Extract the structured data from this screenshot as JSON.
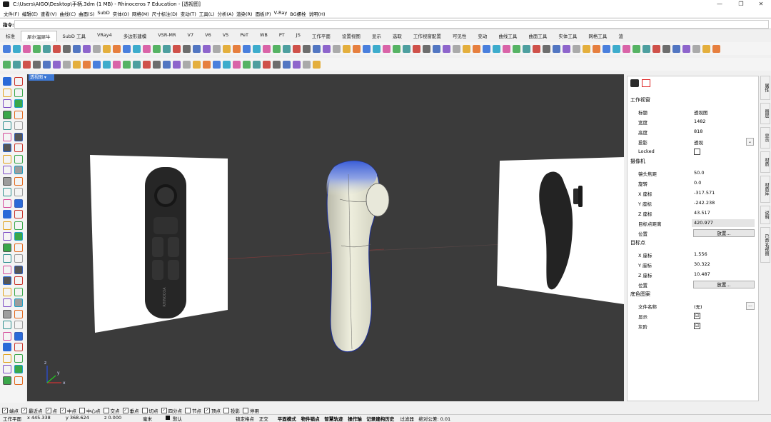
{
  "window": {
    "title": "C:\\Users\\AIGO\\Desktop\\手柄.3dm (1 MB) - Rhinoceros 7 Education - [透视图]",
    "controls": [
      "—",
      "❐",
      "✕"
    ]
  },
  "menu": [
    "文件(F)",
    "编辑(E)",
    "查看(V)",
    "曲线(C)",
    "曲面(S)",
    "SubD",
    "实体(O)",
    "网格(M)",
    "尺寸标注(D)",
    "变动(T)",
    "工具(L)",
    "分析(A)",
    "渲染(R)",
    "面板(P)",
    "V-Ray",
    "BG螺栓",
    "说明(H)"
  ],
  "command": {
    "label": "指令:",
    "value": ""
  },
  "tabs": [
    "标准",
    "犀尔温犀牛",
    "SubD 工具",
    "VRay4",
    "多边形建模",
    "VSR-MR",
    "V7",
    "V6",
    "V5",
    "PeT",
    "WB",
    "PT",
    "JS",
    "工作平面",
    "设置视图",
    "显示",
    "选取",
    "工作视窗配置",
    "可见性",
    "变动",
    "曲线工具",
    "曲面工具",
    "实体工具",
    "网格工具",
    "渲"
  ],
  "active_tab": "犀尔温犀牛",
  "viewport": {
    "label": "透视图"
  },
  "panel": {
    "sections": {
      "viewport": "工作视窗",
      "camera": "摄像机",
      "target": "目标点",
      "wallpaper": "底色图案"
    },
    "viewport_rows": [
      {
        "key": "标题",
        "value": "透视图"
      },
      {
        "key": "宽度",
        "value": "1482"
      },
      {
        "key": "高度",
        "value": "818"
      },
      {
        "key": "投影",
        "value": "透视"
      },
      {
        "key": "Locked",
        "value": ""
      }
    ],
    "camera_rows": [
      {
        "key": "镜头焦距",
        "value": "50.0"
      },
      {
        "key": "旋转",
        "value": "0.0"
      },
      {
        "key": "X 座标",
        "value": "-317.571"
      },
      {
        "key": "Y 座标",
        "value": "-242.238"
      },
      {
        "key": "Z 座标",
        "value": "43.517"
      },
      {
        "key": "目标点距离",
        "value": "420.977"
      },
      {
        "key": "位置",
        "value": "放置..."
      }
    ],
    "target_rows": [
      {
        "key": "X 座标",
        "value": "1.556"
      },
      {
        "key": "Y 座标",
        "value": "30.322"
      },
      {
        "key": "Z 座标",
        "value": "10.487"
      },
      {
        "key": "位置",
        "value": "放置..."
      }
    ],
    "wallpaper_rows": [
      {
        "key": "文件名称",
        "value": "(无)"
      },
      {
        "key": "显示",
        "value": "☑"
      },
      {
        "key": "灰阶",
        "value": "☑"
      }
    ],
    "dots": "..."
  },
  "right_tabs": [
    "属性",
    "图层",
    "显示",
    "材质",
    "材质库",
    "说明",
    "已命名视图"
  ],
  "osnaps": [
    {
      "label": "端点",
      "checked": true
    },
    {
      "label": "最近点",
      "checked": true
    },
    {
      "label": "点",
      "checked": true
    },
    {
      "label": "中点",
      "checked": true
    },
    {
      "label": "中心点",
      "checked": false
    },
    {
      "label": "交点",
      "checked": false
    },
    {
      "label": "垂点",
      "checked": true
    },
    {
      "label": "切点",
      "checked": false
    },
    {
      "label": "四分点",
      "checked": true
    },
    {
      "label": "节点",
      "checked": false
    },
    {
      "label": "顶点",
      "checked": true
    },
    {
      "label": "投影",
      "checked": false
    },
    {
      "label": "停用",
      "checked": false
    }
  ],
  "status": {
    "cplane": "工作平面",
    "x": "x 445.338",
    "y": "y 368.624",
    "z": "z 0.000",
    "unit": "毫米",
    "layer": "默认",
    "toggles": [
      "锁定格点",
      "正交",
      "平面模式",
      "物件锁点",
      "智慧轨迹",
      "操作轴",
      "记录建构历史",
      "过滤器",
      "绝对公差: 0.01"
    ]
  },
  "colors": {
    "accent": "#3f7ad6",
    "viewport_bg": "#3b3b3b",
    "handle_light": "#e4e4d2",
    "handle_dark": "#2a2a2a"
  }
}
